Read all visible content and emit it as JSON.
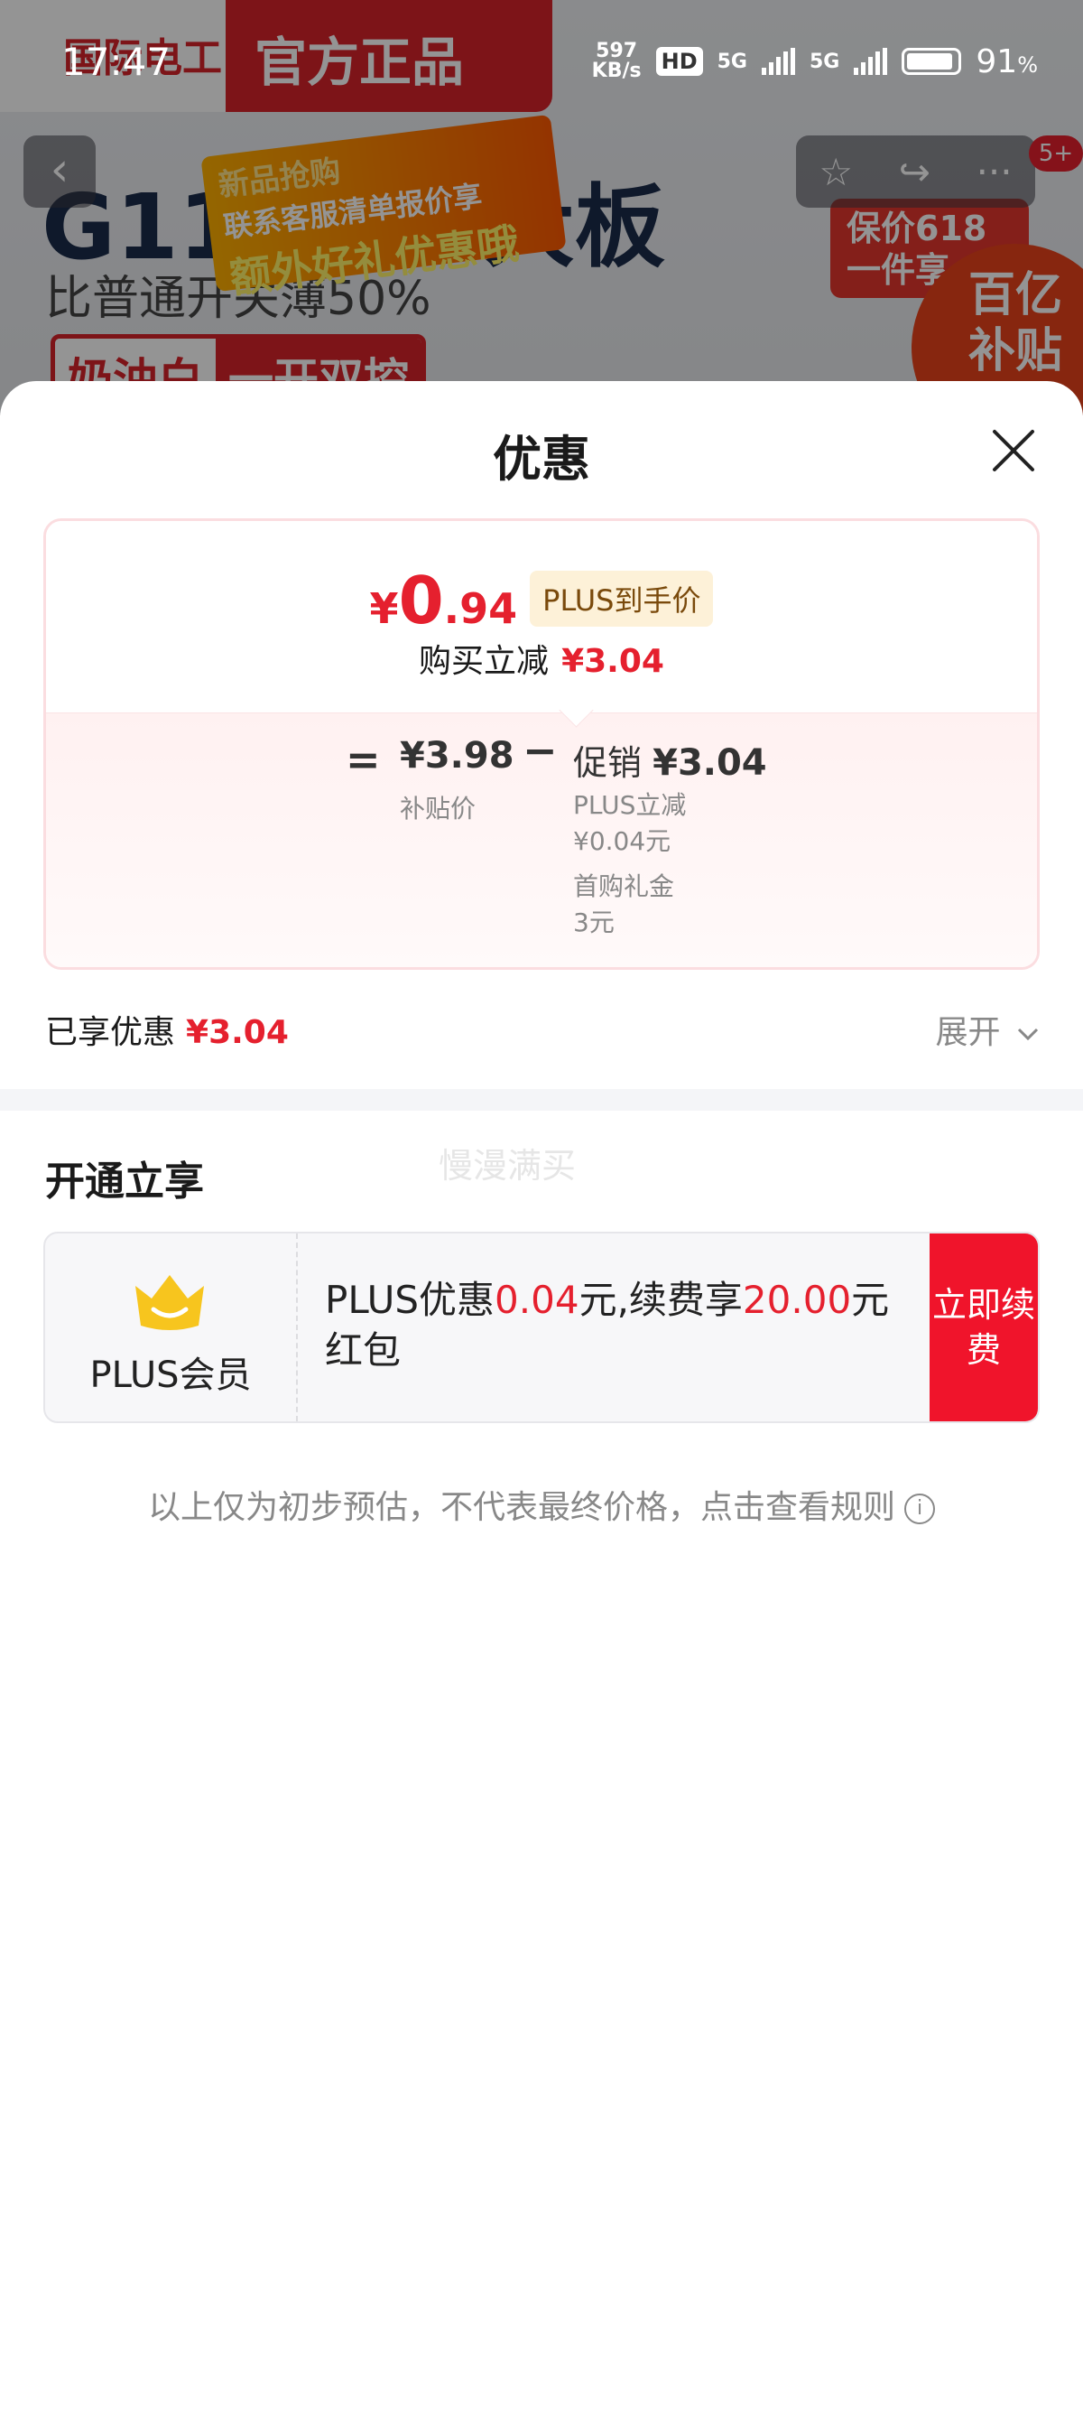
{
  "status_bar": {
    "time": "17:47",
    "net_speed": "597",
    "net_unit": "KB/s",
    "hd": "HD",
    "net1": "5G",
    "net2": "5G",
    "battery": "91",
    "battery_unit": "%"
  },
  "background": {
    "brand": "国际电工",
    "official": "官方正品",
    "headline": "G11",
    "headline_tail": "大板",
    "subline": "比普通开关薄50%",
    "color_a": "奶油白",
    "color_b": "一开双控",
    "promo_line1": "新品抢购",
    "promo_line2": "联系客服清单报价享",
    "promo_line3": "额外好礼优惠哦",
    "guarantee_line1": "保价618",
    "guarantee_line2": "一件享",
    "subsidy_line1": "百亿",
    "subsidy_line2": "补贴",
    "cart_badge": "5+"
  },
  "sheet": {
    "title": "优惠",
    "price": {
      "currency": "¥",
      "integer": "0",
      "decimal": ".94",
      "tag": "PLUS到手价"
    },
    "reduce": {
      "label": "购买立减",
      "amount": "¥3.04"
    },
    "breakdown": {
      "equals": "=",
      "base_price": "¥3.98",
      "base_label": "补贴价",
      "minus": "−",
      "promo_label": "促销",
      "promo_amount": "¥3.04",
      "items": [
        "PLUS立减",
        "¥0.04元",
        "首购礼金",
        "3元"
      ]
    },
    "enjoyed": {
      "label": "已享优惠",
      "amount": "¥3.04"
    },
    "expand_label": "展开"
  },
  "membership": {
    "section_title": "开通立享",
    "watermark": "慢漫满买",
    "name": "PLUS会员",
    "text_a": "PLUS优惠",
    "value_a": "0.04",
    "text_b": "元,续费享",
    "value_b": "20.00",
    "text_c": "元红包",
    "button": "立即续费"
  },
  "footnote": "以上仅为初步预估，不代表最终价格，点击查看规则",
  "colors": {
    "accent_red": "#e5202e",
    "button_red": "#f0142b",
    "plus_tag_bg": "#fdf1d8",
    "crown_gold": "#f7c51e"
  }
}
